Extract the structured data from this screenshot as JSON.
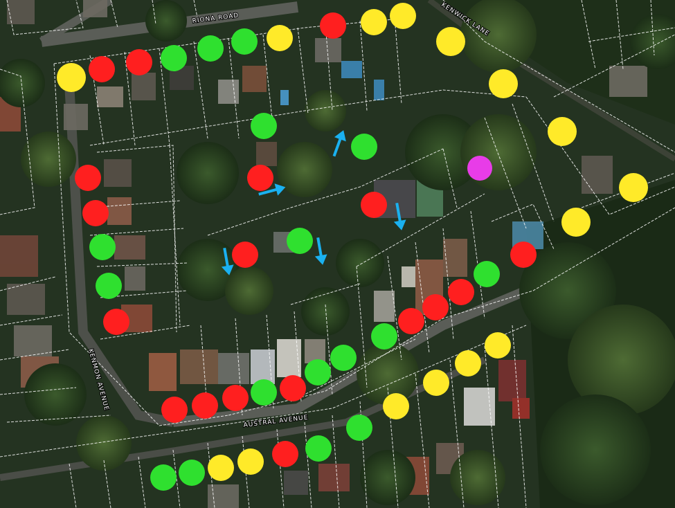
{
  "map": {
    "street_labels": {
      "riona": "RIONA ROAD",
      "kenwick": "KENWICK LANE",
      "kenmon": "KENMON AVENUE",
      "austral": "AUSTRAL AVENUE"
    },
    "colors": {
      "red": "#ff1f1f",
      "yellow": "#ffea29",
      "green": "#2fe02f",
      "magenta": "#e83ce8",
      "arrow": "#1ab1f0",
      "parcel_line": "#ffffff"
    },
    "markers": [
      {
        "color": "yellow"
      },
      {
        "color": "red"
      },
      {
        "color": "red"
      },
      {
        "color": "green"
      },
      {
        "color": "green"
      },
      {
        "color": "green"
      },
      {
        "color": "yellow"
      },
      {
        "color": "red"
      },
      {
        "color": "yellow"
      },
      {
        "color": "yellow"
      },
      {
        "color": "yellow"
      },
      {
        "color": "yellow"
      },
      {
        "color": "yellow"
      },
      {
        "color": "magenta"
      },
      {
        "color": "yellow"
      },
      {
        "color": "yellow"
      },
      {
        "color": "green"
      },
      {
        "color": "green"
      },
      {
        "color": "red"
      },
      {
        "color": "red"
      },
      {
        "color": "red"
      },
      {
        "color": "red"
      },
      {
        "color": "green"
      },
      {
        "color": "green"
      },
      {
        "color": "red"
      },
      {
        "color": "green"
      },
      {
        "color": "green"
      },
      {
        "color": "red"
      },
      {
        "color": "red"
      },
      {
        "color": "red"
      },
      {
        "color": "red"
      },
      {
        "color": "red"
      },
      {
        "color": "green"
      },
      {
        "color": "red"
      },
      {
        "color": "red"
      },
      {
        "color": "red"
      },
      {
        "color": "green"
      },
      {
        "color": "green"
      },
      {
        "color": "red"
      },
      {
        "color": "green"
      },
      {
        "color": "yellow"
      },
      {
        "color": "yellow"
      },
      {
        "color": "yellow"
      },
      {
        "color": "yellow"
      },
      {
        "color": "green"
      },
      {
        "color": "green"
      },
      {
        "color": "red"
      },
      {
        "color": "yellow"
      },
      {
        "color": "yellow"
      },
      {
        "color": "green"
      },
      {
        "color": "green"
      },
      {
        "color": "green"
      }
    ],
    "arrows": [
      {
        "direction": "up"
      },
      {
        "direction": "right"
      },
      {
        "direction": "down"
      },
      {
        "direction": "down"
      },
      {
        "direction": "down"
      }
    ]
  }
}
